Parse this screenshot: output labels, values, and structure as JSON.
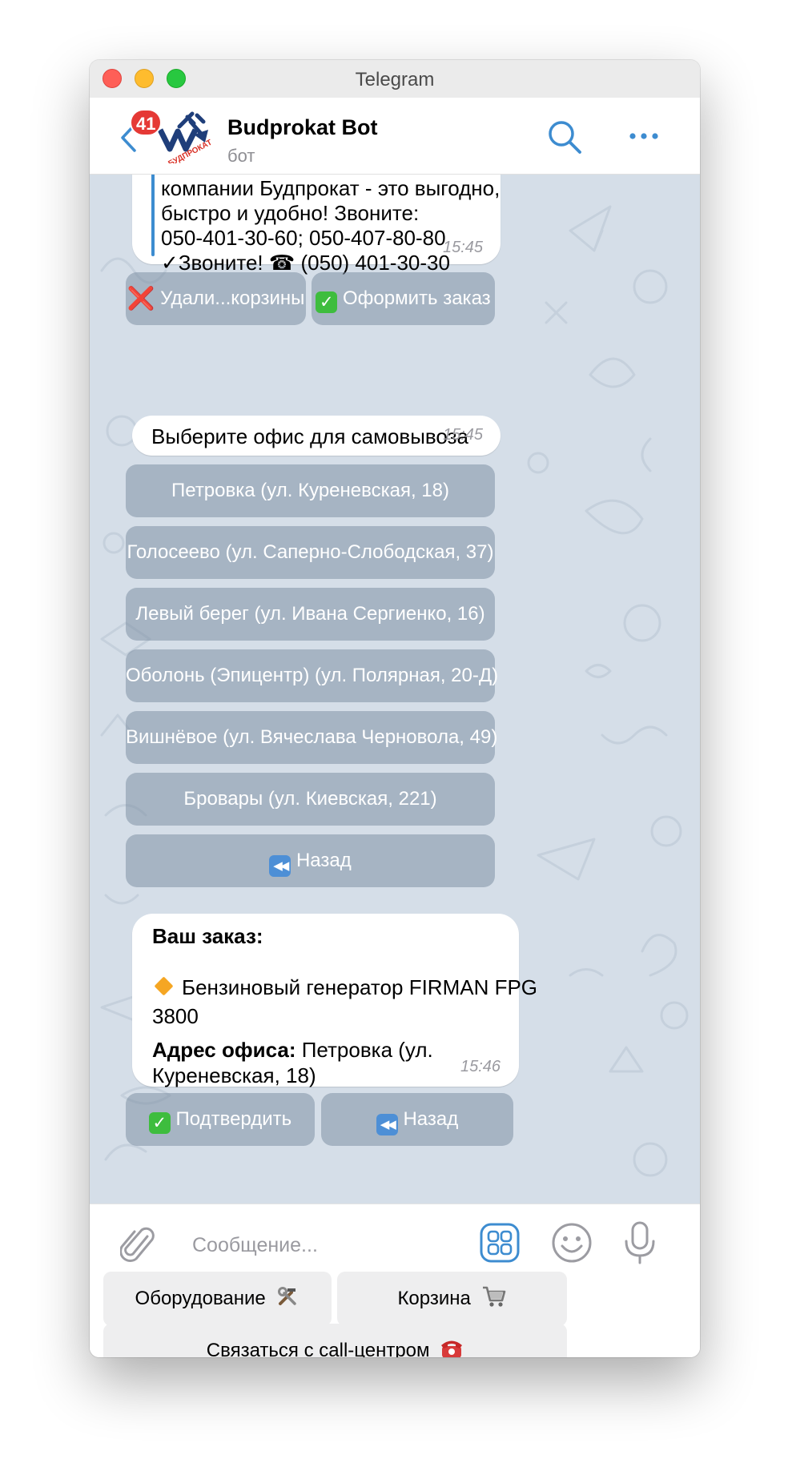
{
  "window": {
    "title": "Telegram"
  },
  "header": {
    "unread_count": "41",
    "chat_name": "Budprokat Bot",
    "chat_status": "бот",
    "logo_text": "БУДПРОКАТ"
  },
  "messages": {
    "m1": {
      "lines": [
        "компании Будпрокат - это выгодно,",
        "быстро и удобно! Звоните:",
        "050-401-30-60; 050-407-80-80",
        "✓Звоните! ☎ (050) 401-30-30"
      ],
      "time": "15:45",
      "buttons": [
        {
          "emoji": "❌",
          "label": "Удали...корзины"
        },
        {
          "emoji": "✅",
          "label": "Оформить заказ"
        }
      ]
    },
    "m2": {
      "text": "Выберите офис для самовывоза",
      "time": "15:45",
      "buttons": [
        {
          "label": "Петровка (ул. Куреневская, 18)"
        },
        {
          "label": "Голосеево (ул. Саперно-Слободская, 37)"
        },
        {
          "label": "Левый берег (ул. Ивана Сергиенко, 16)"
        },
        {
          "label": "Оболонь (Эпицентр) (ул. Полярная, 20-Д)"
        },
        {
          "label": "Вишнёвое (ул. Вячеслава Черновола, 49)"
        },
        {
          "label": "Бровары (ул. Киевская, 221)"
        },
        {
          "emoji": "⏪",
          "label": "Назад"
        }
      ]
    },
    "m3": {
      "heading": "Ваш заказ:",
      "item_line1": "Бензиновый генератор  FIRMAN FPG",
      "item_line2": "3800",
      "address_label": "Адрес офиса:",
      "address_value1": "Петровка (ул.",
      "address_value2": "Куреневская, 18)",
      "time": "15:46",
      "buttons": [
        {
          "emoji": "✅",
          "label": "Подтвердить"
        },
        {
          "emoji": "⏪",
          "label": "Назад"
        }
      ]
    }
  },
  "input": {
    "placeholder": "Сообщение..."
  },
  "reply_keyboard": [
    {
      "label": "Оборудование",
      "icon": "hammer-wrench-icon"
    },
    {
      "label": "Корзина",
      "icon": "shopping-cart-icon"
    },
    {
      "label": "Связаться с call-центром",
      "icon": "telephone-icon"
    }
  ],
  "colors": {
    "accent": "#3d8cd0",
    "chat_background": "#d5dee8",
    "badge": "#e53935",
    "inline_button": "#8e9eb1"
  }
}
